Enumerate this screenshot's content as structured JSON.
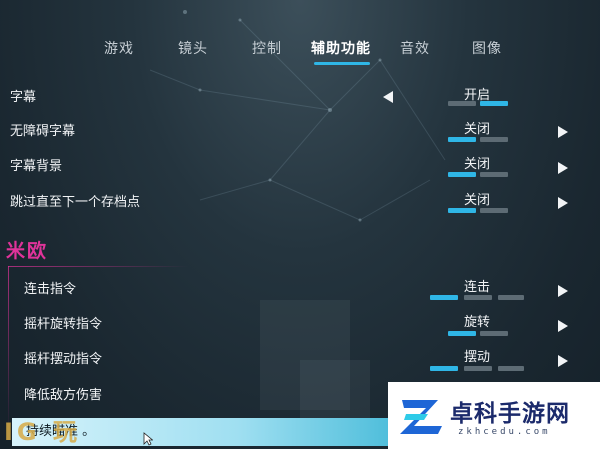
{
  "tabs": [
    {
      "label": "游戏",
      "active": false
    },
    {
      "label": "镜头",
      "active": false
    },
    {
      "label": "控制",
      "active": false
    },
    {
      "label": "辅助功能",
      "active": true
    },
    {
      "label": "音效",
      "active": false
    },
    {
      "label": "图像",
      "active": false
    }
  ],
  "settings": {
    "subtitles": {
      "label": "字幕",
      "value": "开启"
    },
    "accessible_subtitles": {
      "label": "无障碍字幕",
      "value": "关闭"
    },
    "subtitle_background": {
      "label": "字幕背景",
      "value": "关闭"
    },
    "skip_to_checkpoint": {
      "label": "跳过直至下一个存档点",
      "value": "关闭"
    }
  },
  "section": {
    "title": "米欧",
    "combo_command": {
      "label": "连击指令",
      "value": "连击"
    },
    "stick_rotate_command": {
      "label": "摇杆旋转指令",
      "value": "旋转"
    },
    "stick_swing_command": {
      "label": "摇杆摆动指令",
      "value": "摆动"
    },
    "reduce_enemy_damage": {
      "label": "降低敌方伤害"
    },
    "continuous_aim": {
      "label": "持续瞄准 。"
    }
  },
  "corner_mark": "IG 玩",
  "watermark": {
    "title": "卓科手游网",
    "url": "zkhcedu.com"
  },
  "colors": {
    "accent": "#2fb6e6",
    "section": "#e0339a",
    "highlight": "#9fdff1"
  }
}
